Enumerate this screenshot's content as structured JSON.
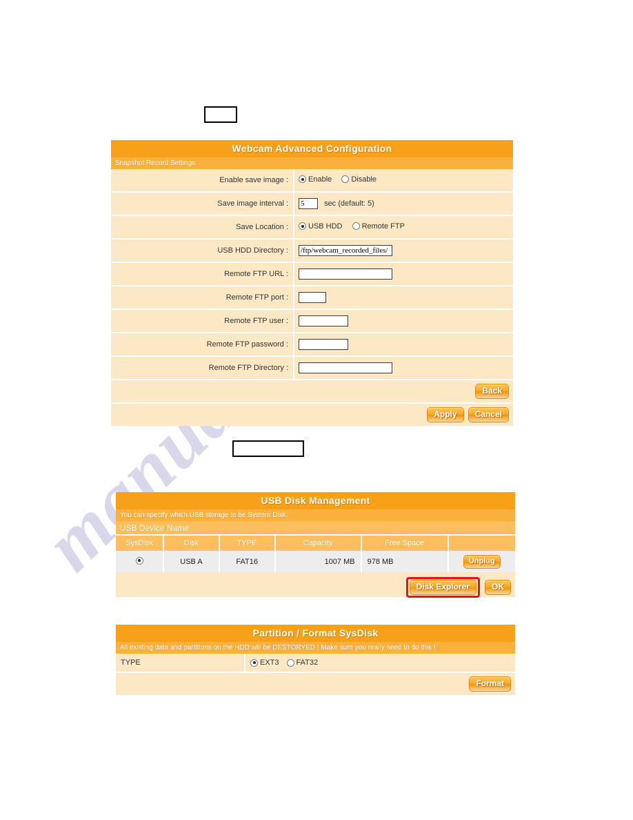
{
  "watermark": {
    "text": "manualshive.com"
  },
  "blank_boxes": [
    {
      "name": "blank-callout-top",
      "label": ""
    },
    {
      "name": "blank-callout-middle",
      "label": ""
    }
  ],
  "webcam_panel": {
    "title": "Webcam Advanced Configuration",
    "subtitle": "Snapshot Record Settings",
    "rows": [
      {
        "label": "Enable save image :",
        "type": "radio",
        "options": [
          {
            "label": "Enable",
            "selected": true
          },
          {
            "label": "Disable",
            "selected": false
          }
        ]
      },
      {
        "label": "Save image interval :",
        "type": "text-suffix",
        "value": "5",
        "suffix": "sec (default: 5)"
      },
      {
        "label": "Save Location :",
        "type": "radio",
        "options": [
          {
            "label": "USB HDD",
            "selected": true
          },
          {
            "label": "Remote FTP",
            "selected": false
          }
        ]
      },
      {
        "label": "USB HDD Directory :",
        "type": "text",
        "value": "/ftp/webcam_recorded_files/"
      },
      {
        "label": "Remote FTP URL :",
        "type": "text",
        "value": ""
      },
      {
        "label": "Remote FTP port :",
        "type": "text",
        "value": ""
      },
      {
        "label": "Remote FTP user :",
        "type": "text",
        "value": ""
      },
      {
        "label": "Remote FTP password :",
        "type": "text",
        "value": ""
      },
      {
        "label": "Remote FTP Directory :",
        "type": "text",
        "value": ""
      }
    ],
    "buttons": {
      "back": "Back",
      "apply": "Apply",
      "cancel": "Cancel"
    }
  },
  "usb_panel": {
    "title": "USB Disk Management",
    "subtitle": "You can specify which USB storage to be System Disk.",
    "device_name_header": "USB Device Name",
    "columns": [
      "SysDisk",
      "Disk",
      "TYPE",
      "Capacity",
      "Free Space",
      ""
    ],
    "rows": [
      {
        "sysdisk_selected": true,
        "disk": "USB A",
        "type": "FAT16",
        "capacity": "1007 MB",
        "free_space": "978 MB",
        "action": "Unplug"
      }
    ],
    "buttons": {
      "disk_explorer": "Disk Explorer",
      "ok": "OK"
    },
    "highlight": {
      "target": "disk_explorer",
      "color": "#EE1111"
    }
  },
  "partition_panel": {
    "title": "Partition / Format SysDisk",
    "subtitle": "All existing data and partitions on the HDD will be DESTORYED ! Make sure you really need to do this !",
    "type_label": "TYPE",
    "type_options": [
      {
        "label": "EXT3",
        "selected": true
      },
      {
        "label": "FAT32",
        "selected": false
      }
    ],
    "buttons": {
      "format": "Format"
    }
  },
  "colors": {
    "title_orange": "#F7A11A",
    "sub_orange": "#FBB03B",
    "header_orange": "#FDBF5E",
    "row_cream": "#FCE8C4",
    "data_grey": "#EDEDED",
    "highlight_red": "#EE1111"
  }
}
